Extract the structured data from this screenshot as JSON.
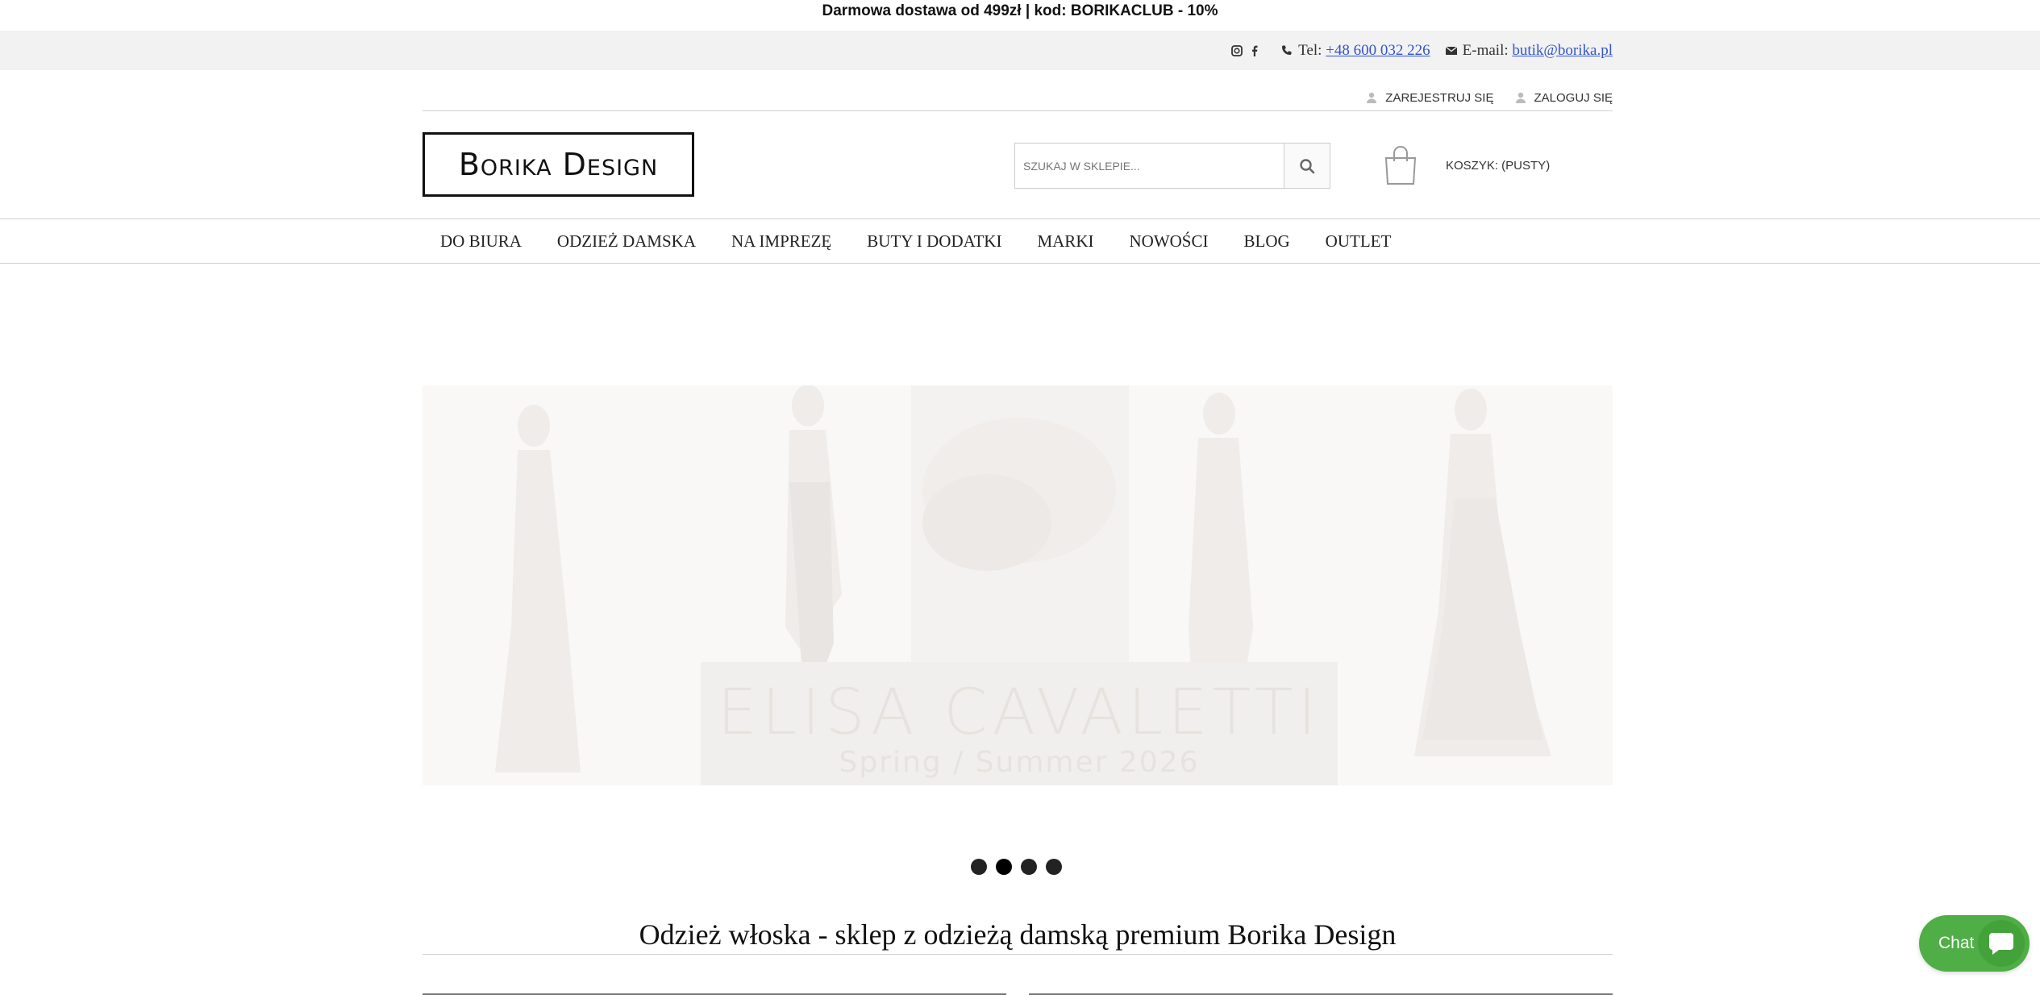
{
  "promo": {
    "text": "Darmowa dostawa od 499zł | kod: BORIKACLUB - 10%"
  },
  "contact": {
    "tel_label": "Tel:",
    "tel_value": "+48 600 032 226",
    "email_label": "E-mail:",
    "email_value": "butik@borika.pl",
    "icons": [
      "instagram-icon",
      "facebook-icon",
      "phone-icon",
      "envelope-icon"
    ]
  },
  "account": {
    "register": "ZAREJESTRUJ SIĘ",
    "login": "ZALOGUJ SIĘ"
  },
  "logo": {
    "text": "Borika Design"
  },
  "search": {
    "placeholder": "SZUKAJ W SKLEPIE..."
  },
  "cart": {
    "label": "KOSZYK: (PUSTY)"
  },
  "nav": {
    "items": [
      "DO BIURA",
      "ODZIEŻ DAMSKA",
      "NA IMPREZĘ",
      "BUTY I DODATKI",
      "MARKI",
      "NOWOŚCI",
      "BLOG",
      "OUTLET"
    ]
  },
  "slider": {
    "caption_title": "ELISA CAVALETTI",
    "caption_subtitle": "Spring / Summer 2026",
    "slide_count": 4
  },
  "main": {
    "heading": "Odzież włoska - sklep z odzieżą damską premium Borika Design"
  },
  "chat": {
    "label": "Chat"
  },
  "colors": {
    "chat_green": "#4fae45",
    "link_blue": "#3355cc",
    "contact_bg": "#f2f2f2"
  }
}
